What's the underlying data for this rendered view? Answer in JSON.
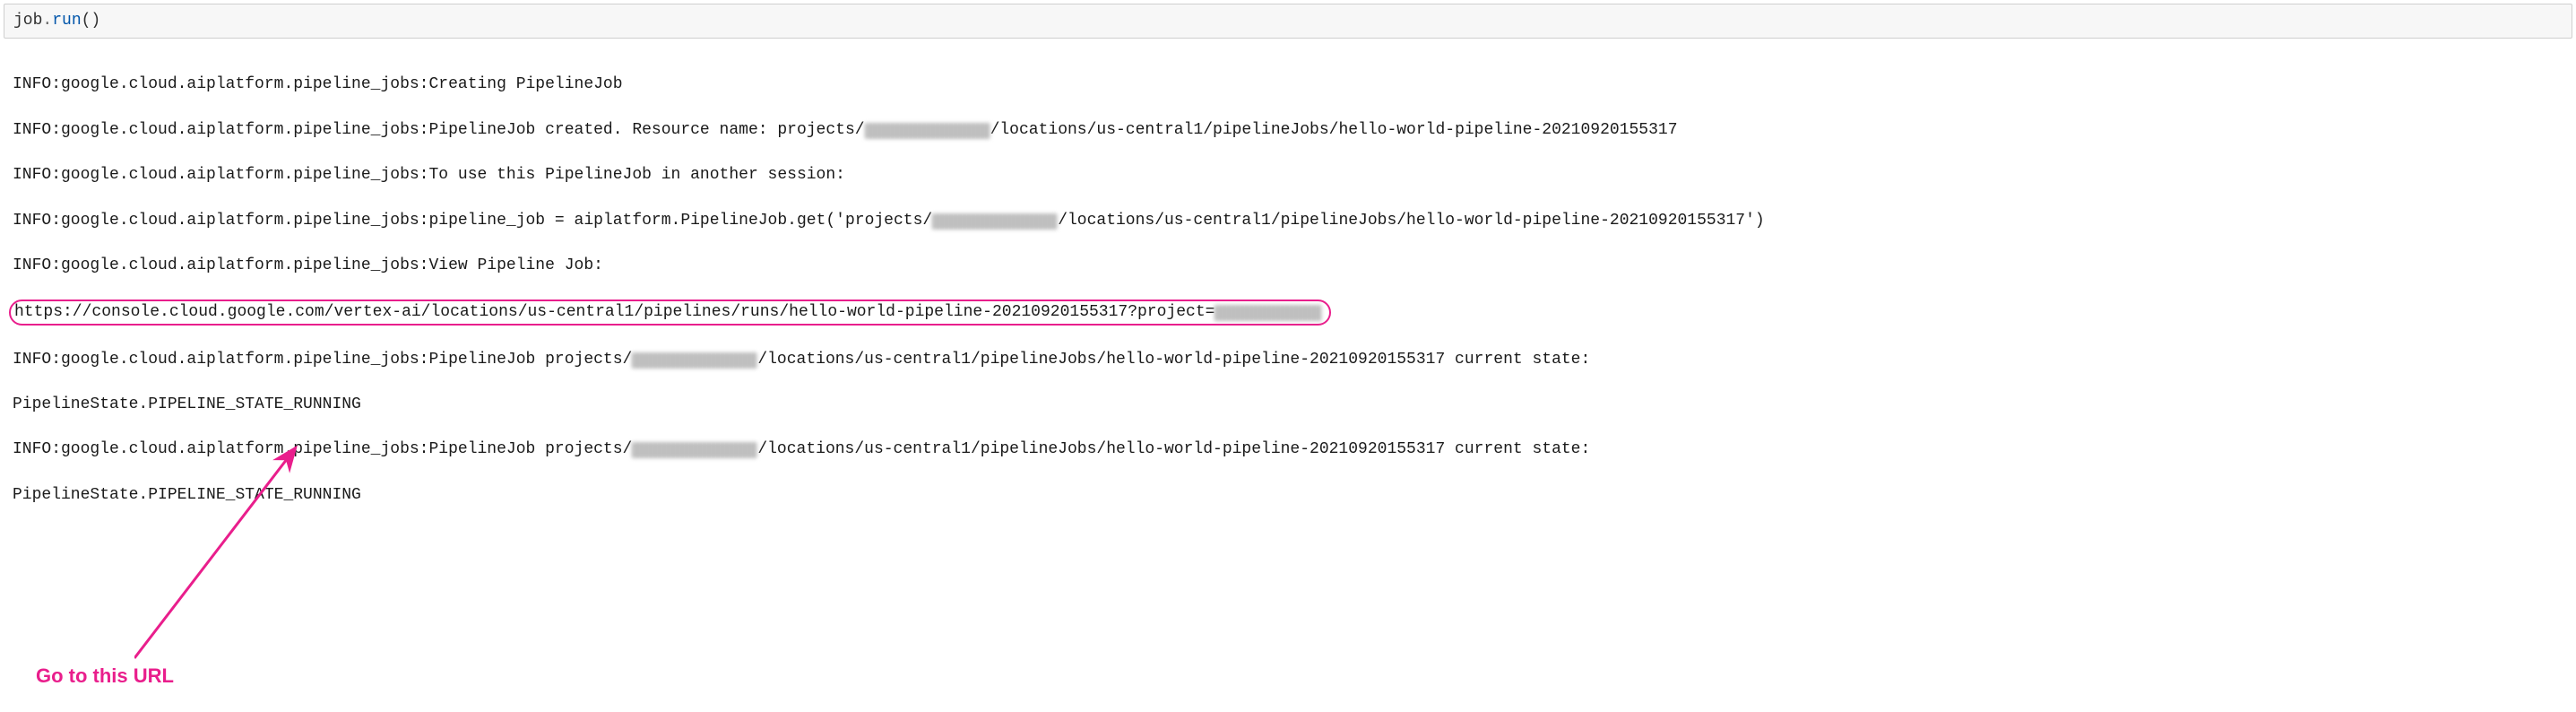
{
  "code": {
    "obj": "job",
    "method": "run",
    "parens": "()"
  },
  "log": {
    "prefix": "INFO:google.cloud.aiplatform.pipeline_jobs:",
    "l1_suffix": "Creating PipelineJob",
    "l2_a": "PipelineJob created. Resource name: projects/",
    "l2_b": "/locations/us-central1/pipelineJobs/hello-world-pipeline-20210920155317",
    "l3_suffix": "To use this PipelineJob in another session:",
    "l4_a": "pipeline_job = aiplatform.PipelineJob.get('projects/",
    "l4_b": "/locations/us-central1/pipelineJobs/hello-world-pipeline-20210920155317')",
    "l5_suffix": "View Pipeline Job:",
    "l6_a": "https://console.cloud.google.com/vertex-ai/locations/us-central1/pipelines/runs/hello-world-pipeline-20210920155317?project=",
    "l7_a": "PipelineJob projects/",
    "l7_b": "/locations/us-central1/pipelineJobs/hello-world-pipeline-20210920155317 current state:",
    "l8": "PipelineState.PIPELINE_STATE_RUNNING",
    "l9_a": "PipelineJob projects/",
    "l9_b": "/locations/us-central1/pipelineJobs/hello-world-pipeline-20210920155317 current state:",
    "l10": "PipelineState.PIPELINE_STATE_RUNNING"
  },
  "annotation": {
    "label": "Go to this URL"
  }
}
